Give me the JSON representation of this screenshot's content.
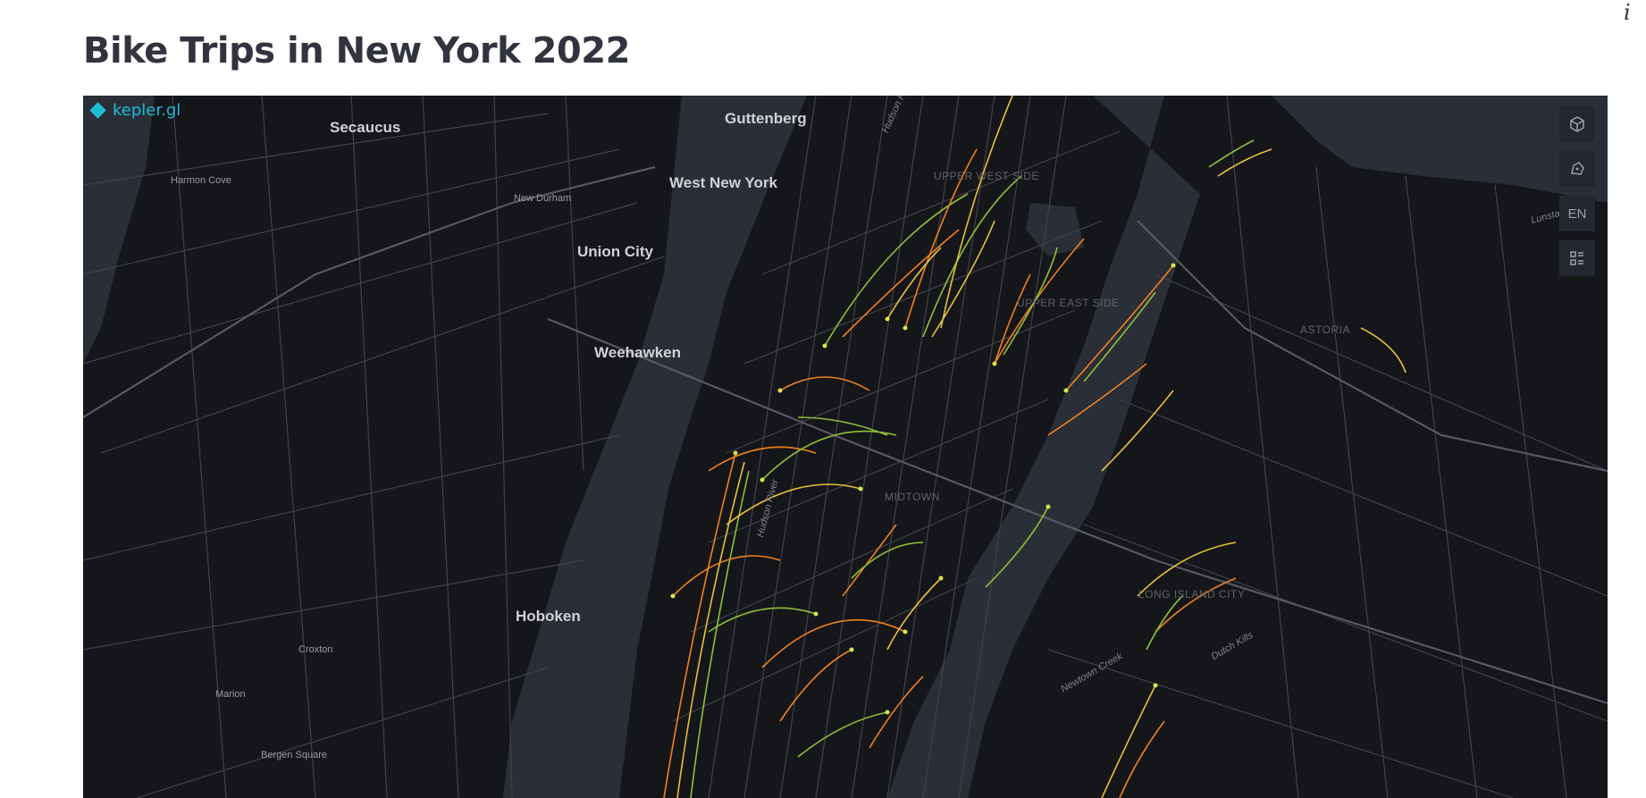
{
  "title": "Bike Trips in New York 2022",
  "info_icon": "i",
  "map": {
    "logo_text": "kepler.gl",
    "colors": {
      "background": "#15161a",
      "water": "#2a2f37",
      "roads": "#4a4b55",
      "arc_orange": "#f0821e",
      "arc_green": "#8fbf3a",
      "arc_yellow": "#e6c23a",
      "point": "#d8e64a"
    },
    "labels": {
      "secaucus": "Secaucus",
      "harmon_cove": "Harmon Cove",
      "new_durham": "New Durham",
      "guttenberg": "Guttenberg",
      "west_new_york": "West New York",
      "union_city": "Union City",
      "weehawken": "Weehawken",
      "hoboken": "Hoboken",
      "croxton": "Croxton",
      "marion": "Marion",
      "bergen_square": "Bergen Square",
      "upper_west_side": "UPPER WEST SIDE",
      "upper_east_side": "UPPER EAST SIDE",
      "midtown": "MIDTOWN",
      "astoria": "ASTORIA",
      "long_island_city": "LONG ISLAND CITY",
      "hudson_river_1": "Hudson River",
      "hudson_river_2": "Hudson R",
      "newtown_creek": "Newtown Creek",
      "dutch_kills": "Dutch Kills",
      "lunsta": "Lunsta"
    },
    "controls": {
      "view_3d_icon": "cube-icon",
      "draw_icon": "polygon-draw-icon",
      "locale": "EN",
      "legend_icon": "legend-icon"
    }
  }
}
